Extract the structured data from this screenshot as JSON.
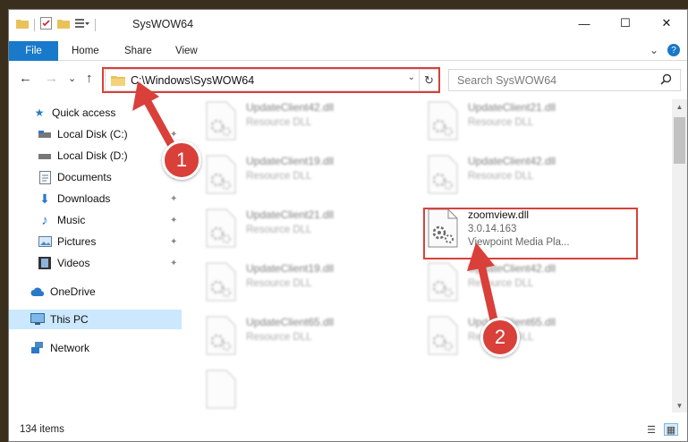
{
  "window": {
    "title": "SysWOW64",
    "controls": {
      "minimize": "—",
      "maximize": "☐",
      "close": "✕"
    }
  },
  "ribbon": {
    "file_tab": "File",
    "tabs": [
      "Home",
      "Share",
      "View"
    ],
    "expand": "⌄",
    "help": "?"
  },
  "nav": {
    "back": "←",
    "forward": "→",
    "recent": "⌄",
    "up": "↑",
    "address": "C:\\Windows\\SysWOW64",
    "address_dropdown": "⌄",
    "refresh": "↻",
    "search_placeholder": "Search SysWOW64"
  },
  "sidebar": {
    "items": [
      {
        "label": "Quick access",
        "icon": "star-icon",
        "glyph": "★",
        "color": "#2a78c8",
        "pinned": false
      },
      {
        "label": "Local Disk (C:)",
        "icon": "drive-icon",
        "glyph": "▬",
        "color": "#555555",
        "pinned": true
      },
      {
        "label": "Local Disk (D:)",
        "icon": "drive-icon",
        "glyph": "▬",
        "color": "#555555",
        "pinned": true
      },
      {
        "label": "Documents",
        "icon": "documents-icon",
        "glyph": "▤",
        "color": "#5a6c80",
        "pinned": true
      },
      {
        "label": "Downloads",
        "icon": "download-icon",
        "glyph": "⬇",
        "color": "#2a78c8",
        "pinned": true
      },
      {
        "label": "Music",
        "icon": "music-icon",
        "glyph": "♪",
        "color": "#2a78c8",
        "pinned": true
      },
      {
        "label": "Pictures",
        "icon": "pictures-icon",
        "glyph": "▨",
        "color": "#3d7fbf",
        "pinned": true
      },
      {
        "label": "Videos",
        "icon": "videos-icon",
        "glyph": "▥",
        "color": "#3a3a3a",
        "pinned": true
      },
      {
        "label": "OneDrive",
        "icon": "cloud-icon",
        "glyph": "☁",
        "color": "#2a78c8",
        "pinned": false
      },
      {
        "label": "This PC",
        "icon": "computer-icon",
        "glyph": "▭",
        "color": "#2a78c8",
        "pinned": false
      },
      {
        "label": "Network",
        "icon": "network-icon",
        "glyph": "⊞",
        "color": "#2a78c8",
        "pinned": false
      }
    ],
    "pin_glyph": "✦"
  },
  "files": [
    {
      "name": "UpdateClient42.dll",
      "type": "Resource DLL",
      "blurred": true
    },
    {
      "name": "UpdateClient21.dll",
      "type": "Resource DLL",
      "blurred": true
    },
    {
      "name": "UpdateClient19.dll",
      "type": "Resource DLL",
      "blurred": true
    },
    {
      "name": "UpdateClient42.dll",
      "type": "Resource DLL",
      "blurred": true
    },
    {
      "name": "UpdateClient21.dll",
      "type": "Resource DLL",
      "blurred": true
    },
    {
      "name": "zoomview.dll",
      "version": "3.0.14.163",
      "type": "Viewpoint Media Pla...",
      "blurred": false
    },
    {
      "name": "UpdateClient19.dll",
      "type": "Resource DLL",
      "blurred": true
    },
    {
      "name": "UpdateClient42.dll",
      "type": "Resource DLL",
      "blurred": true
    },
    {
      "name": "UpdateClient65.dll",
      "type": "Resource DLL",
      "blurred": true
    },
    {
      "name": "UpdateClient65.dll",
      "type": "Resource DLL",
      "blurred": true
    }
  ],
  "status": {
    "items_count": "134 items"
  },
  "callouts": [
    "1",
    "2"
  ],
  "colors": {
    "accent": "#1979ca",
    "highlight": "#d9403a",
    "selected": "#cce8ff"
  }
}
